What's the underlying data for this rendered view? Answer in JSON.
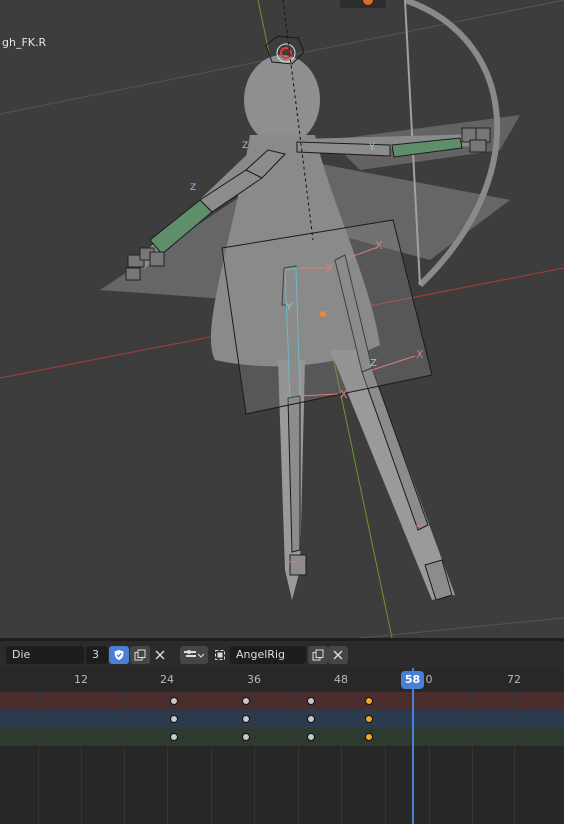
{
  "viewport": {
    "bone_label": "gh_FK.R",
    "axis_labels": {
      "x": "X",
      "y": "Y",
      "z": "Z"
    }
  },
  "timeline": {
    "action_name": "Die",
    "user_count": "3",
    "armature_name": "AngelRig",
    "frame_labels": [
      "12",
      "24",
      "36",
      "48",
      "0",
      "72"
    ],
    "current_frame": "58",
    "channels": [
      {
        "name": "channel-red",
        "color": "#4a2d2d",
        "keys": [
          "white",
          "white",
          "white",
          "orange"
        ]
      },
      {
        "name": "channel-blue",
        "color": "#2b3a4d",
        "keys": [
          "white",
          "white",
          "white",
          "orange"
        ]
      },
      {
        "name": "channel-green",
        "color": "#2c3a2f",
        "keys": [
          "white",
          "white",
          "white",
          "orange"
        ]
      }
    ],
    "key_colors": {
      "white": "#c8c8c8",
      "orange": "#f2a72b"
    }
  },
  "icons": [
    "shield-icon",
    "copy-icon",
    "close-icon",
    "keying-mode-icon",
    "armature-icon",
    "chevron-down-icon"
  ]
}
